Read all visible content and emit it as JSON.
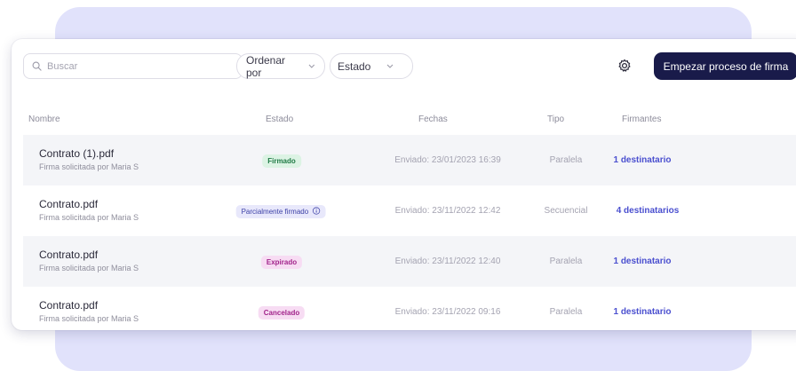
{
  "toolbar": {
    "search_placeholder": "Buscar",
    "sort_label": "Ordenar por",
    "status_label": "Estado",
    "cta_label": "Empezar proceso de firma"
  },
  "table": {
    "headers": {
      "name": "Nombre",
      "status": "Estado",
      "dates": "Fechas",
      "type": "Tipo",
      "signers": "Firmantes"
    },
    "rows": [
      {
        "file": "Contrato (1).pdf",
        "requested": "Firma solicitada por Maria S",
        "status": "Firmado",
        "date": "Enviado: 23/01/2023 16:39",
        "type": "Paralela",
        "signers": "1 destinatario"
      },
      {
        "file": "Contrato.pdf",
        "requested": "Firma solicitada por Maria S",
        "status": "Parcialmente firmado",
        "date": "Enviado: 23/11/2022 12:42",
        "type": "Secuencial",
        "signers": "4 destinatarios"
      },
      {
        "file": "Contrato.pdf",
        "requested": "Firma solicitada por Maria S",
        "status": "Expirado",
        "date": "Enviado: 23/11/2022 12:40",
        "type": "Paralela",
        "signers": "1 destinatario"
      },
      {
        "file": "Contrato.pdf",
        "requested": "Firma solicitada por Maria S",
        "status": "Cancelado",
        "date": "Enviado: 23/11/2022 09:16",
        "type": "Paralela",
        "signers": "1 destinatario"
      }
    ]
  },
  "colors": {
    "accent": "#191b4a",
    "link": "#4a4fcf",
    "backdrop": "#e1e2fb"
  }
}
